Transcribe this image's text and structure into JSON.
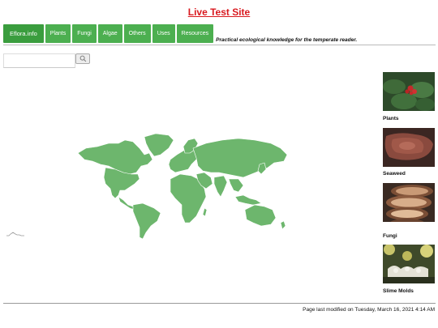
{
  "site": {
    "title": "Live Test Site"
  },
  "nav": {
    "brand": "Eflora.info",
    "items": [
      "Plants",
      "Fungi",
      "Algae",
      "Others",
      "Uses",
      "Resources"
    ],
    "tagline": "Practical ecological knowledge for the temperate reader."
  },
  "search": {
    "value": "",
    "button_icon": "search-icon"
  },
  "map": {
    "icon": "world-map-icon",
    "color": "#6db66d"
  },
  "sidebar": [
    {
      "label": "Plants",
      "icon": "plant-photo"
    },
    {
      "label": "Seaweed",
      "icon": "seaweed-photo"
    },
    {
      "label": "Fungi",
      "icon": "fungi-photo"
    },
    {
      "label": "Slime Molds",
      "icon": "slime-mold-photo"
    }
  ],
  "footer": {
    "modified": "Page last modified on Tuesday, March 16, 2021 4:14 AM"
  },
  "colors": {
    "nav_green": "#4caf50",
    "title_red": "#d9191f"
  }
}
